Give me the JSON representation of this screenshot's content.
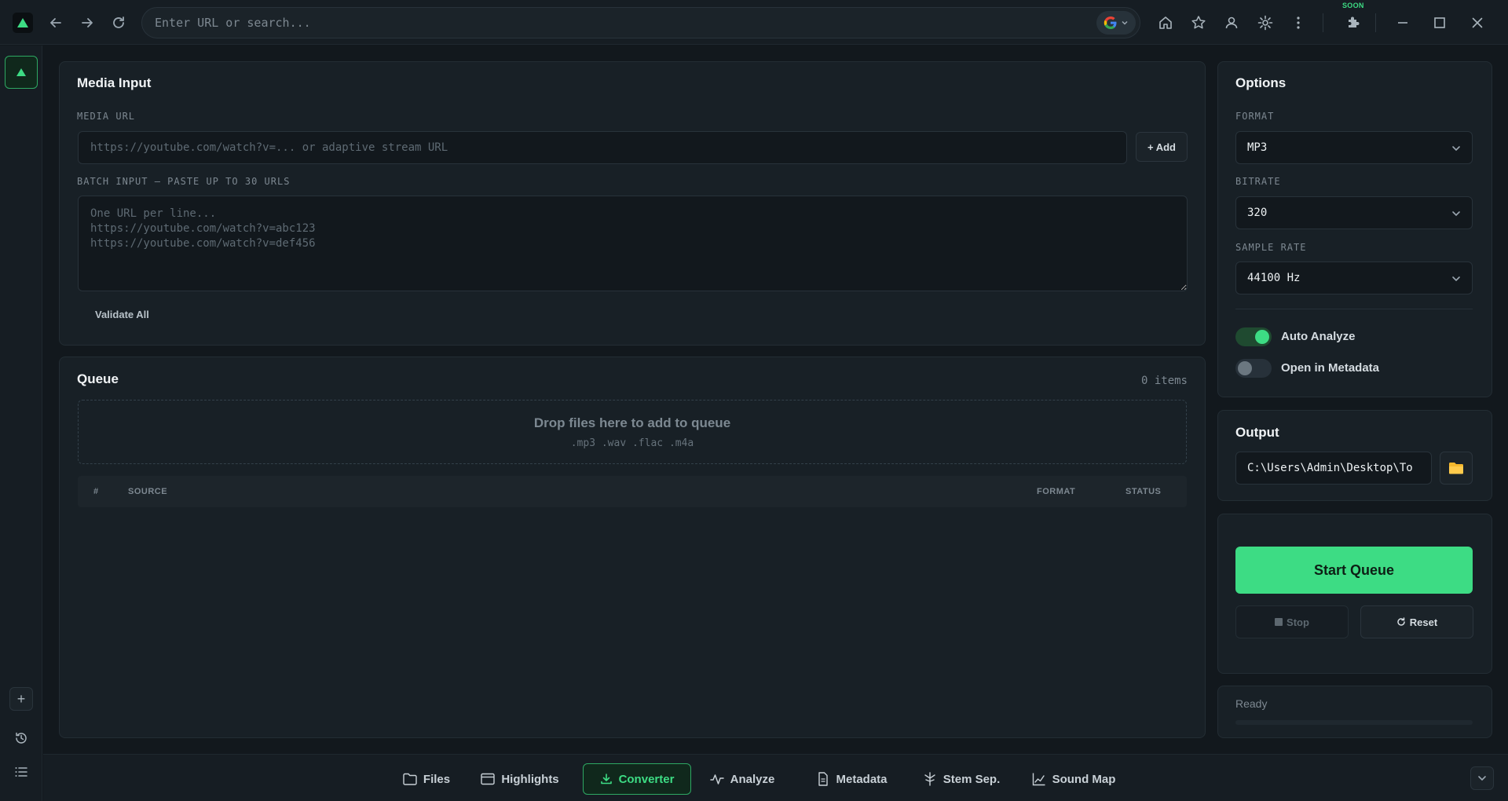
{
  "browser": {
    "url_placeholder": "Enter URL or search...",
    "soon_label": "SOON",
    "icons": [
      "back-icon",
      "forward-icon",
      "reload-icon",
      "google-icon",
      "home-icon",
      "star-icon",
      "user-icon",
      "gear-icon",
      "kebab-icon",
      "puzzle-icon",
      "minimize-icon",
      "maximize-icon",
      "close-icon"
    ]
  },
  "sidebar": {
    "add_label": "+"
  },
  "media_input": {
    "title": "Media Input",
    "url_label": "MEDIA URL",
    "url_placeholder": "https://youtube.com/watch?v=... or adaptive stream URL",
    "add_label": "+ Add",
    "batch_label": "BATCH INPUT — PASTE UP TO 30 URLS",
    "batch_placeholder": "One URL per line...\nhttps://youtube.com/watch?v=abc123\nhttps://youtube.com/watch?v=def456",
    "validate_label": "Validate All"
  },
  "queue": {
    "title": "Queue",
    "count": "0 items",
    "drop_title": "Drop files here to add to queue",
    "drop_formats": ".mp3 .wav .flac .m4a",
    "columns": {
      "num": "#",
      "source": "SOURCE",
      "format": "FORMAT",
      "status": "STATUS"
    }
  },
  "options": {
    "title": "Options",
    "format_label": "FORMAT",
    "format_value": "MP3",
    "bitrate_label": "BITRATE",
    "bitrate_value": "320",
    "sample_rate_label": "SAMPLE RATE",
    "sample_rate_value": "44100 Hz",
    "auto_analyze_label": "Auto Analyze",
    "auto_analyze_on": true,
    "open_metadata_label": "Open in Metadata",
    "open_metadata_on": false
  },
  "output": {
    "title": "Output",
    "path": "C:\\Users\\Admin\\Desktop\\To"
  },
  "controls": {
    "start_label": "Start Queue",
    "stop_label": "Stop",
    "reset_label": "Reset"
  },
  "status": {
    "text": "Ready",
    "progress": 0
  },
  "tabs": [
    {
      "label": "Files",
      "icon": "folder-icon",
      "active": false
    },
    {
      "label": "Highlights",
      "icon": "browser-window-icon",
      "active": false
    },
    {
      "label": "Converter",
      "icon": "download-icon",
      "active": true
    },
    {
      "label": "Analyze",
      "icon": "pulse-icon",
      "active": false
    },
    {
      "label": "Metadata",
      "icon": "document-icon",
      "active": false
    },
    {
      "label": "Stem Sep.",
      "icon": "split-icon",
      "active": false
    },
    {
      "label": "Sound Map",
      "icon": "chart-icon",
      "active": false
    }
  ],
  "colors": {
    "accent": "#3ddc84",
    "background": "#12181d",
    "panel": "#182026"
  }
}
